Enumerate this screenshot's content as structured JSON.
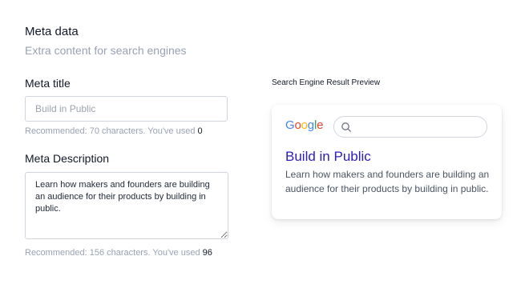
{
  "section": {
    "title": "Meta data",
    "subtitle": "Extra content for search engines"
  },
  "meta_title": {
    "label": "Meta title",
    "placeholder": "Build in Public",
    "value": "",
    "hint_prefix": "Recommended: 70 characters. You've used",
    "used_count": "0"
  },
  "meta_description": {
    "label": "Meta Description",
    "value": "Learn how makers and founders are building an audience for their products by building in public.",
    "hint_prefix": "Recommended: 156 characters. You've used",
    "used_count": "96"
  },
  "preview": {
    "label": "Search Engine Result Preview",
    "logo_text": "Google",
    "logo_colors": [
      "#4285F4",
      "#EA4335",
      "#FBBC05",
      "#4285F4",
      "#34A853",
      "#EA4335"
    ],
    "search_icon": "search-icon",
    "result_title": "Build in Public",
    "result_description": "Learn how makers and founders are building an audience for their products by building in public."
  }
}
